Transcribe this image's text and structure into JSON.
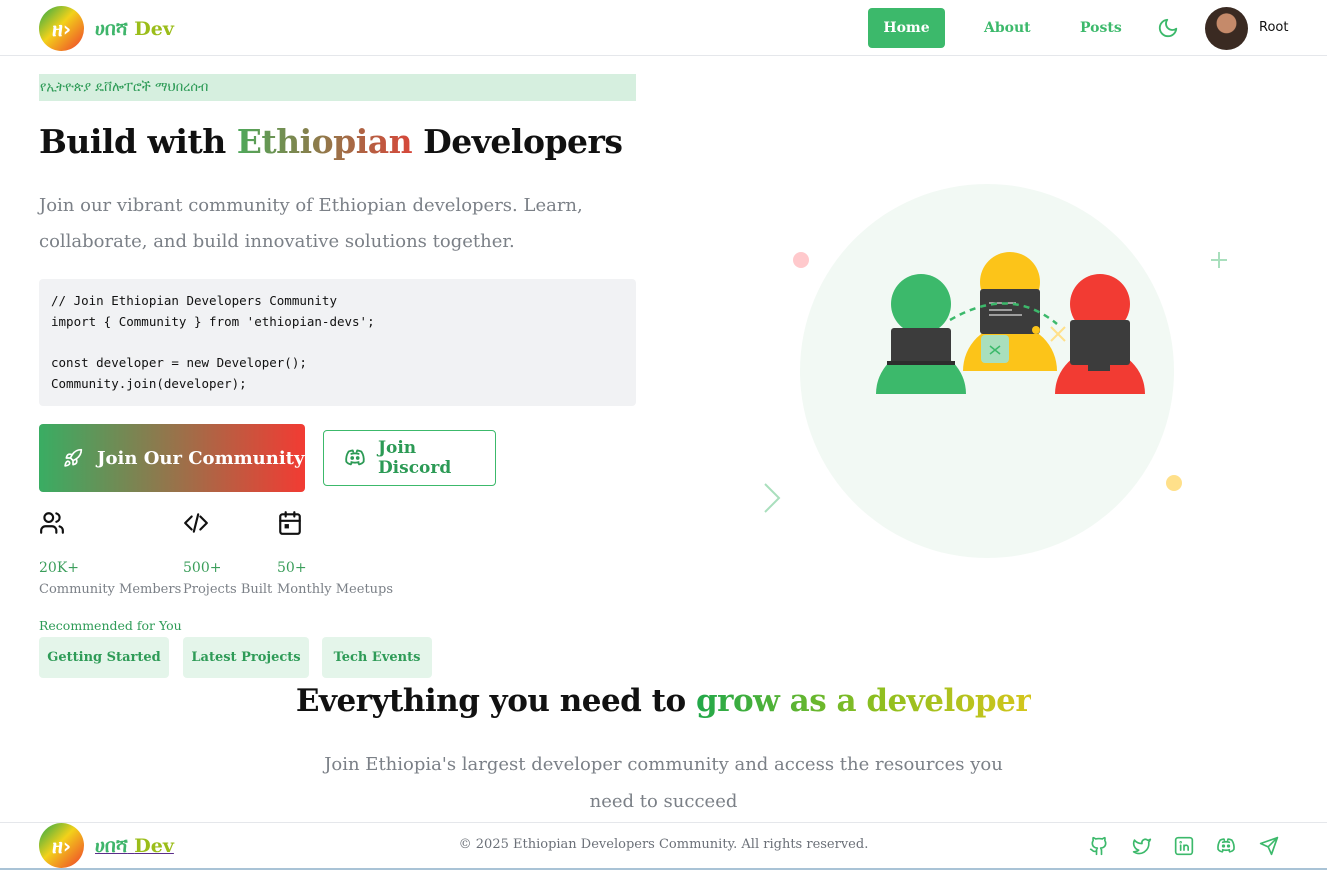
{
  "header": {
    "logo_mark": "ዘ›",
    "brand_prefix": "ሀበሻ",
    "brand_suffix": "Dev",
    "nav": {
      "home": "Home",
      "about": "About",
      "posts": "Posts"
    },
    "username": "Root"
  },
  "hero": {
    "badge": "የኢትዮጵያ ዴቨሎፐሮች ማህበረሰብ",
    "title_pre": "Build with",
    "title_highlight": "Ethiopian",
    "title_post": "Developers",
    "subtitle": "Join our vibrant community of Ethiopian developers. Learn, collaborate, and build innovative solutions together.",
    "code": "// Join Ethiopian Developers Community\nimport { Community } from 'ethiopian-devs';\n\nconst developer = new Developer();\nCommunity.join(developer);",
    "primary_button": "Join Our Community",
    "secondary_button": "Join Discord"
  },
  "stats": [
    {
      "icon": "users-icon",
      "value": "20K+",
      "label": "Community Members"
    },
    {
      "icon": "code-icon",
      "value": "500+",
      "label": "Projects Built"
    },
    {
      "icon": "calendar-icon",
      "value": "50+",
      "label": "Monthly Meetups"
    }
  ],
  "recommended": {
    "label": "Recommended for You",
    "items": [
      "Getting Started",
      "Latest Projects",
      "Tech Events"
    ]
  },
  "section": {
    "title_pre": "Everything you need to",
    "title_highlight": "grow as a developer",
    "subtitle": "Join Ethiopia's largest developer community and access the resources you need to succeed"
  },
  "footer": {
    "brand_prefix": "ሀበሻ",
    "brand_suffix": "Dev",
    "copyright": "© 2025 Ethiopian Developers Community. All rights reserved.",
    "social": [
      "github-icon",
      "twitter-icon",
      "linkedin-icon",
      "discord-icon",
      "telegram-icon"
    ]
  },
  "colors": {
    "accent": "#3cb96b",
    "red": "#f23b33",
    "yellow": "#fcc419"
  }
}
